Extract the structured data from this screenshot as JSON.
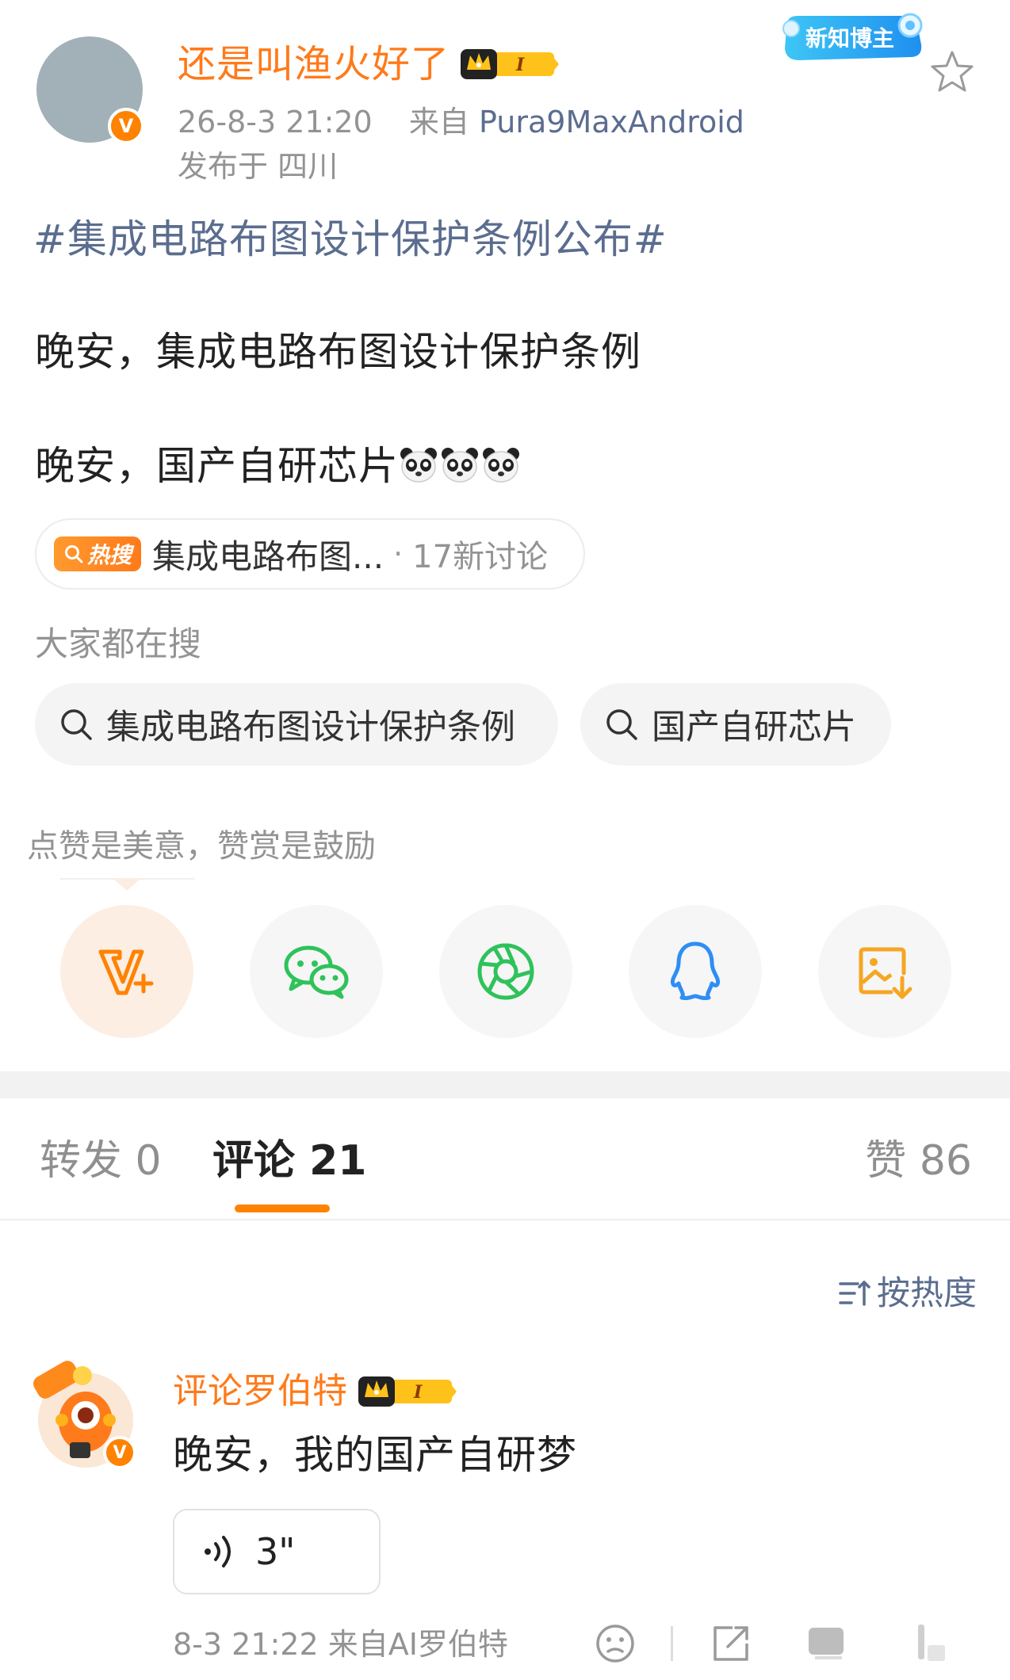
{
  "post": {
    "author": "还是叫渔火好了",
    "level_badge": "I",
    "time": "26-8-3 21:20",
    "source_prefix": "来自",
    "source": "Pura9MaxAndroid",
    "location": "发布于 四川",
    "new_blogger_badge": "新知博主",
    "topic": "#集成电路布图设计保护条例公布#",
    "line1": "晚安，集成电路布图设计保护条例",
    "line2": "晚安，国产自研芯片",
    "emoji_name": "panda-emoji"
  },
  "hot_search": {
    "tag": "热搜",
    "title": "集成电路布图...",
    "dot": "·",
    "count": "17新讨论"
  },
  "everyone_search": {
    "label": "大家都在搜",
    "chips": [
      "集成电路布图设计保护条例",
      "国产自研芯片"
    ]
  },
  "reward": {
    "tip": "点赞是美意，赞赏是鼓励",
    "buttons": [
      "reward-v-plus-icon",
      "wechat-icon",
      "moments-icon",
      "qq-icon",
      "save-image-icon"
    ]
  },
  "tabs": {
    "repost": "转发 0",
    "comment": "评论 21",
    "like": "赞 86"
  },
  "sort": {
    "label": "按热度"
  },
  "comment": {
    "author": "评论罗伯特",
    "level_badge": "I",
    "text": "晚安，我的国产自研梦",
    "voice_duration": "3\"",
    "meta": "8-3 21:22  来自AI罗伯特"
  },
  "colors": {
    "accent_orange": "#ff8200",
    "link_blue": "#5b6d8f",
    "wechat_green": "#2fc25b",
    "qq_blue": "#2f8ef4",
    "save_orange": "#f5a623"
  }
}
